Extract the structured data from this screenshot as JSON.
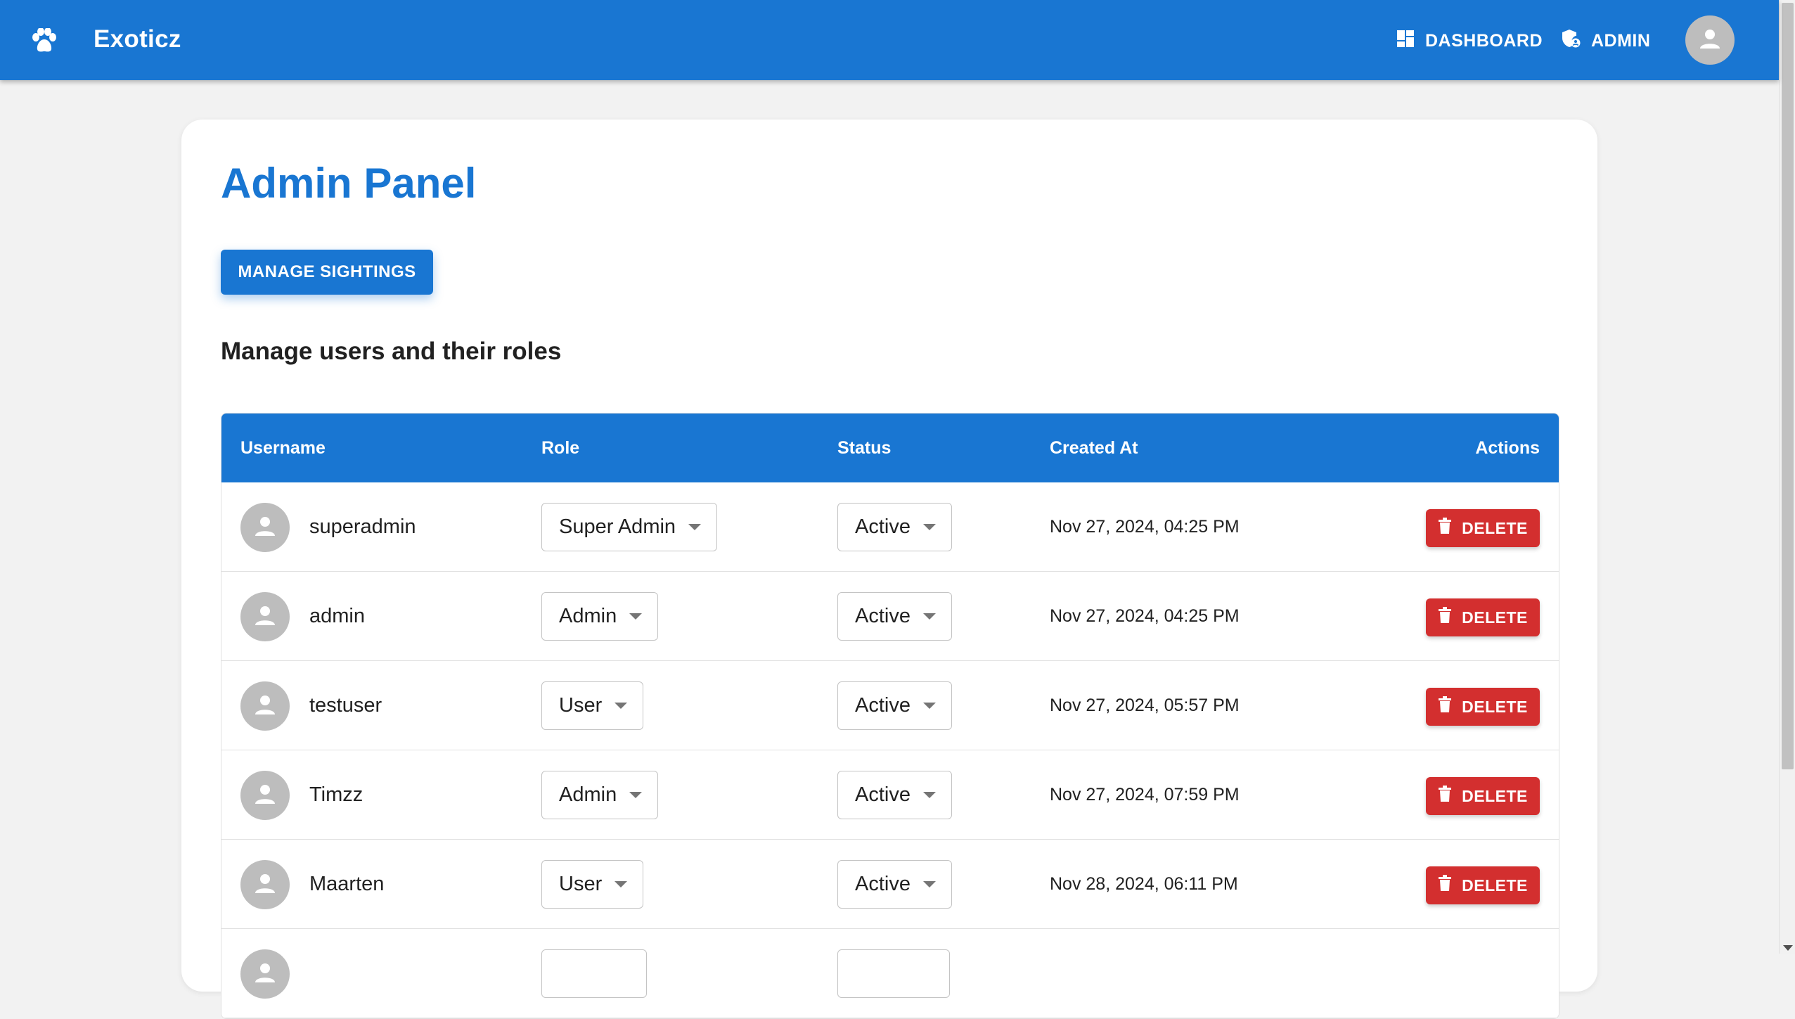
{
  "app": {
    "brand": "Exoticz",
    "logo_icon": "paw-icon",
    "nav": {
      "dashboard_label": "DASHBOARD",
      "dashboard_icon": "dashboard-icon",
      "admin_label": "ADMIN",
      "admin_icon": "admin-shield-icon"
    },
    "avatar_icon": "person-icon"
  },
  "colors": {
    "primary": "#1976d2",
    "danger": "#d32f2f",
    "avatar_bg": "#bdbdbd",
    "page_bg": "#f2f2f2"
  },
  "main": {
    "title": "Admin Panel",
    "manage_sightings_label": "MANAGE SIGHTINGS",
    "subtitle": "Manage users and their roles"
  },
  "table": {
    "headers": {
      "username": "Username",
      "role": "Role",
      "status": "Status",
      "created_at": "Created At",
      "actions": "Actions"
    },
    "delete_label": "DELETE",
    "rows": [
      {
        "username": "superadmin",
        "role": "Super Admin",
        "status": "Active",
        "created_at": "Nov 27, 2024, 04:25 PM"
      },
      {
        "username": "admin",
        "role": "Admin",
        "status": "Active",
        "created_at": "Nov 27, 2024, 04:25 PM"
      },
      {
        "username": "testuser",
        "role": "User",
        "status": "Active",
        "created_at": "Nov 27, 2024, 05:57 PM"
      },
      {
        "username": "Timzz",
        "role": "Admin",
        "status": "Active",
        "created_at": "Nov 27, 2024, 07:59 PM"
      },
      {
        "username": "Maarten",
        "role": "User",
        "status": "Active",
        "created_at": "Nov 28, 2024, 06:11 PM"
      },
      {
        "username": "",
        "role": "",
        "status": "",
        "created_at": ""
      }
    ]
  }
}
